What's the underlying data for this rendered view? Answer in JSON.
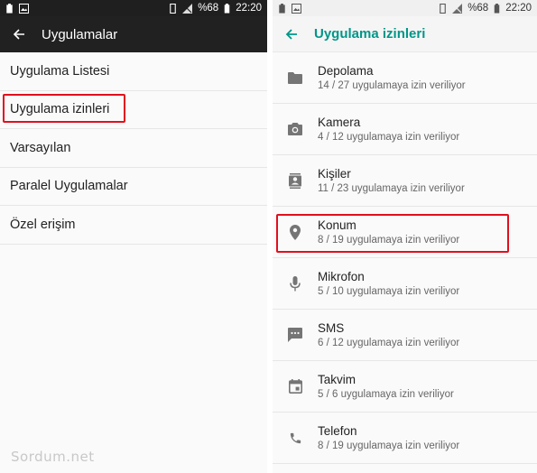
{
  "left": {
    "status": {
      "battery": "%68",
      "time": "22:20"
    },
    "appbar": {
      "title": "Uygulamalar"
    },
    "menu": [
      {
        "label": "Uygulama Listesi"
      },
      {
        "label": "Uygulama izinleri"
      },
      {
        "label": "Varsayılan"
      },
      {
        "label": "Paralel Uygulamalar"
      },
      {
        "label": "Özel erişim"
      }
    ],
    "watermark": "Sordum.net"
  },
  "right": {
    "status": {
      "battery": "%68",
      "time": "22:20"
    },
    "appbar": {
      "title": "Uygulama izinleri"
    },
    "permissions": [
      {
        "title": "Depolama",
        "subtitle": "14 / 27 uygulamaya izin veriliyor",
        "icon": "folder-icon"
      },
      {
        "title": "Kamera",
        "subtitle": "4 / 12 uygulamaya izin veriliyor",
        "icon": "camera-icon"
      },
      {
        "title": "Kişiler",
        "subtitle": "11 / 23 uygulamaya izin veriliyor",
        "icon": "contacts-icon"
      },
      {
        "title": "Konum",
        "subtitle": "8 / 19 uygulamaya izin veriliyor",
        "icon": "location-icon"
      },
      {
        "title": "Mikrofon",
        "subtitle": "5 / 10 uygulamaya izin veriliyor",
        "icon": "microphone-icon"
      },
      {
        "title": "SMS",
        "subtitle": "6 / 12 uygulamaya izin veriliyor",
        "icon": "sms-icon"
      },
      {
        "title": "Takvim",
        "subtitle": "5 / 6 uygulamaya izin veriliyor",
        "icon": "calendar-icon"
      },
      {
        "title": "Telefon",
        "subtitle": "8 / 19 uygulamaya izin veriliyor",
        "icon": "phone-icon"
      }
    ]
  },
  "colors": {
    "accent": "#009688",
    "highlight": "#e0101e",
    "dark_bar": "#212121"
  }
}
